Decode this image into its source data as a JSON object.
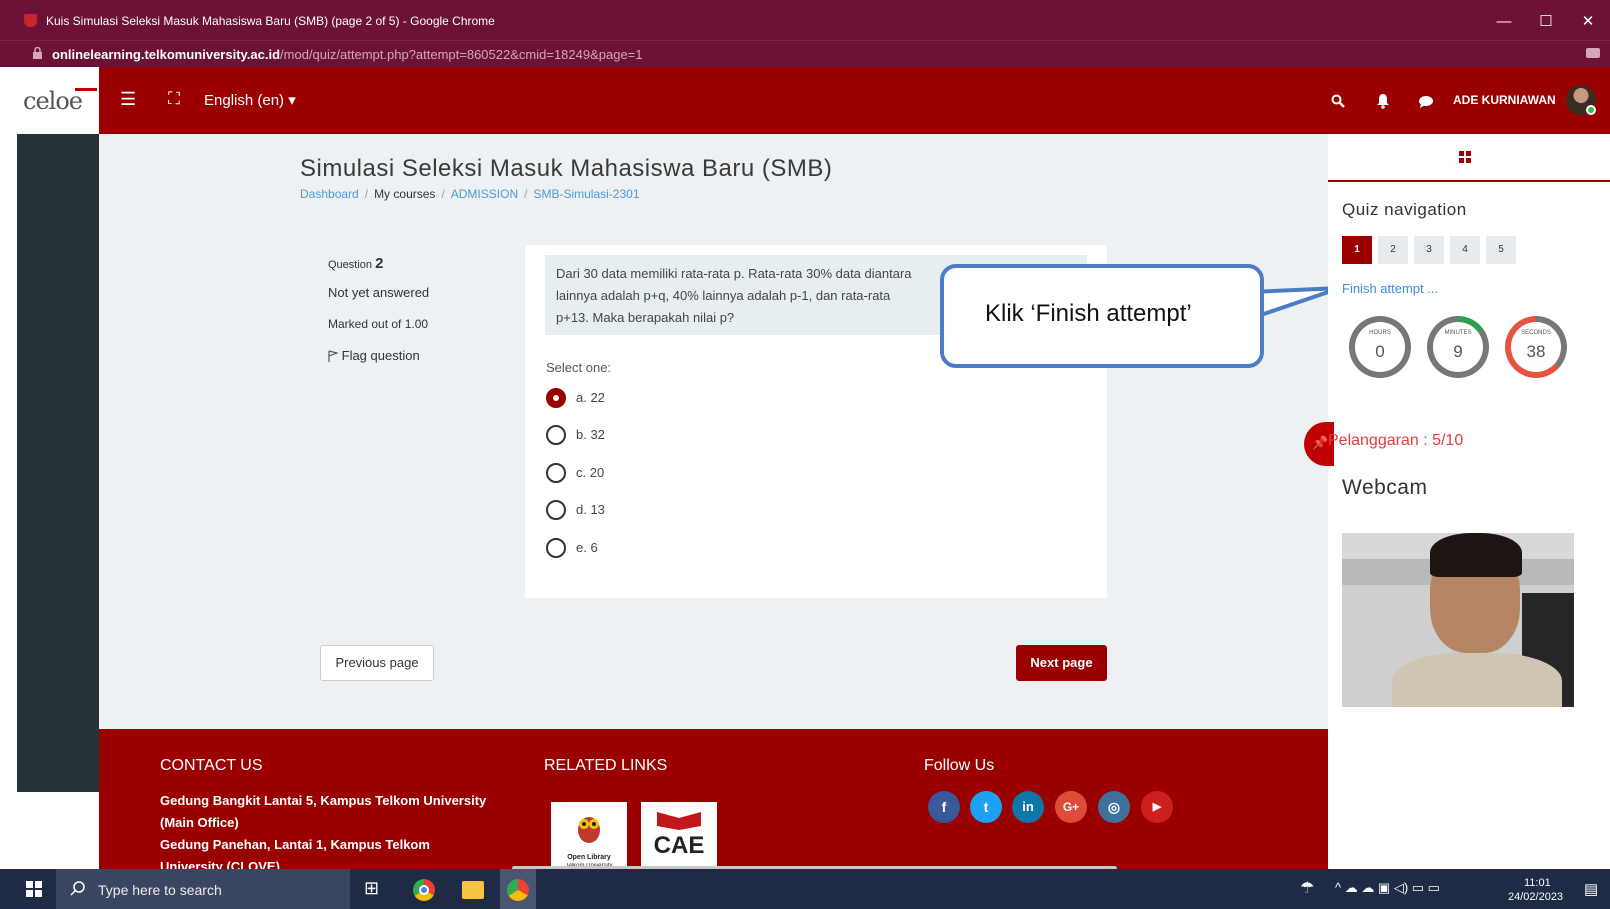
{
  "browser": {
    "tab_title": "Kuis Simulasi Seleksi Masuk Mahasiswa Baru (SMB) (page 2 of 5) - Google Chrome",
    "url_host": "onlinelearning.telkomuniversity.ac.id",
    "url_path": "/mod/quiz/attempt.php?attempt=860522&cmid=18249&page=1",
    "minimize": "—",
    "maximize": "☐",
    "close": "✕"
  },
  "navbar": {
    "logo": "celoe",
    "menu_icon": "☰",
    "fullscreen_icon": "⛶",
    "language": "English (en) ▾",
    "search_icon": "⚲",
    "bell_icon": "🔔",
    "chat_icon": "💬",
    "username": "ADE KURNIAWAN"
  },
  "page": {
    "title": "Simulasi Seleksi Masuk Mahasiswa Baru (SMB)",
    "breadcrumb": [
      "Dashboard",
      "My courses",
      "ADMISSION",
      "SMB-Simulasi-2301"
    ],
    "breadcrumb_sep": "/"
  },
  "question": {
    "label": "Question",
    "number": "2",
    "status": "Not yet answered",
    "marks": "Marked out of 1.00",
    "flag": "Flag question",
    "text_line1": "Dari 30 data memiliki rata-rata p. Rata-rata 30% data diantara",
    "text_line2": "lainnya adalah p+q, 40% lainnya adalah p-1, dan rata-rata",
    "text_line3": "p+13. Maka berapakah nilai p?",
    "select_one": "Select one:",
    "options": [
      {
        "label": "a. 22",
        "selected": true
      },
      {
        "label": "b. 32",
        "selected": false
      },
      {
        "label": "c. 20",
        "selected": false
      },
      {
        "label": "d. 13",
        "selected": false
      },
      {
        "label": "e. 6",
        "selected": false
      }
    ],
    "prev_button": "Previous page",
    "next_button": "Next page"
  },
  "callout": {
    "text": "Klik ‘Finish attempt’"
  },
  "quiz_nav": {
    "title": "Quiz navigation",
    "pages": [
      "1",
      "2",
      "3",
      "4",
      "5"
    ],
    "current": "1",
    "finish_link": "Finish attempt ...",
    "timer": {
      "hours_label": "HOURS",
      "hours": "0",
      "minutes_label": "MINUTES",
      "minutes": "9",
      "seconds_label": "SECONDS",
      "seconds": "38"
    },
    "violation": "Pelanggaran : 5/10",
    "webcam_title": "Webcam"
  },
  "footer": {
    "contact_title": "CONTACT US",
    "contact_line1": "Gedung Bangkit Lantai 5, Kampus Telkom University",
    "contact_line2": "(Main Office)",
    "contact_line3": "Gedung Panehan, Lantai 1, Kampus Telkom",
    "contact_line4": "University (CLOVE)",
    "related_title": "RELATED LINKS",
    "related_logo1_line1": "Open Library",
    "related_logo1_line2": "Telkom University",
    "related_logo2": "CAE",
    "follow_title": "Follow Us",
    "social": [
      "f",
      "t",
      "in",
      "G+",
      "◎",
      "▶"
    ]
  },
  "taskbar": {
    "search_placeholder": "Type here to search",
    "time": "11:01",
    "date": "24/02/2023"
  },
  "colors": {
    "brand_red": "#9b0000",
    "chrome_frame": "#6b1236",
    "callout_border": "#4b7cc4",
    "link_blue": "#3a8fd6"
  }
}
